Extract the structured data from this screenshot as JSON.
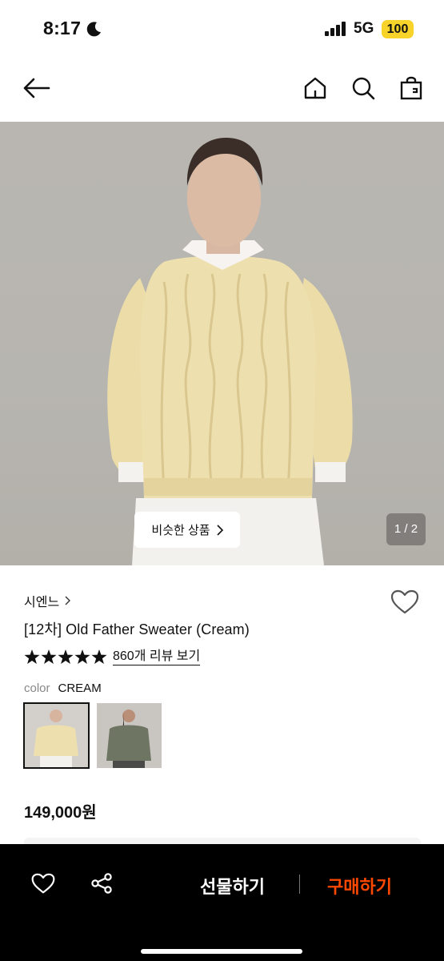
{
  "status": {
    "time": "8:17",
    "network": "5G",
    "battery": "100"
  },
  "gallery": {
    "similar_label": "비슷한 상품",
    "page": "1 / 2"
  },
  "product": {
    "brand": "시엔느",
    "title": "[12차] Old Father Sweater (Cream)",
    "rating_stars": 5,
    "review_link": "860개 리뷰 보기",
    "color_label": "color",
    "color_value": "CREAM",
    "price": "149,000원"
  },
  "actions": {
    "gift_label": "선물하기",
    "buy_label": "구매하기"
  },
  "colors": {
    "buy_accent": "#ff4800",
    "battery": "#f8d32a",
    "sweater_cream": "#eee0ae",
    "sweater_grey": "#6f7563"
  },
  "icons": [
    "moon-icon",
    "signal-icon",
    "back-arrow-icon",
    "home-icon",
    "search-icon",
    "shopping-bag-icon",
    "chevron-right-icon",
    "heart-icon",
    "star-icon",
    "share-icon"
  ]
}
